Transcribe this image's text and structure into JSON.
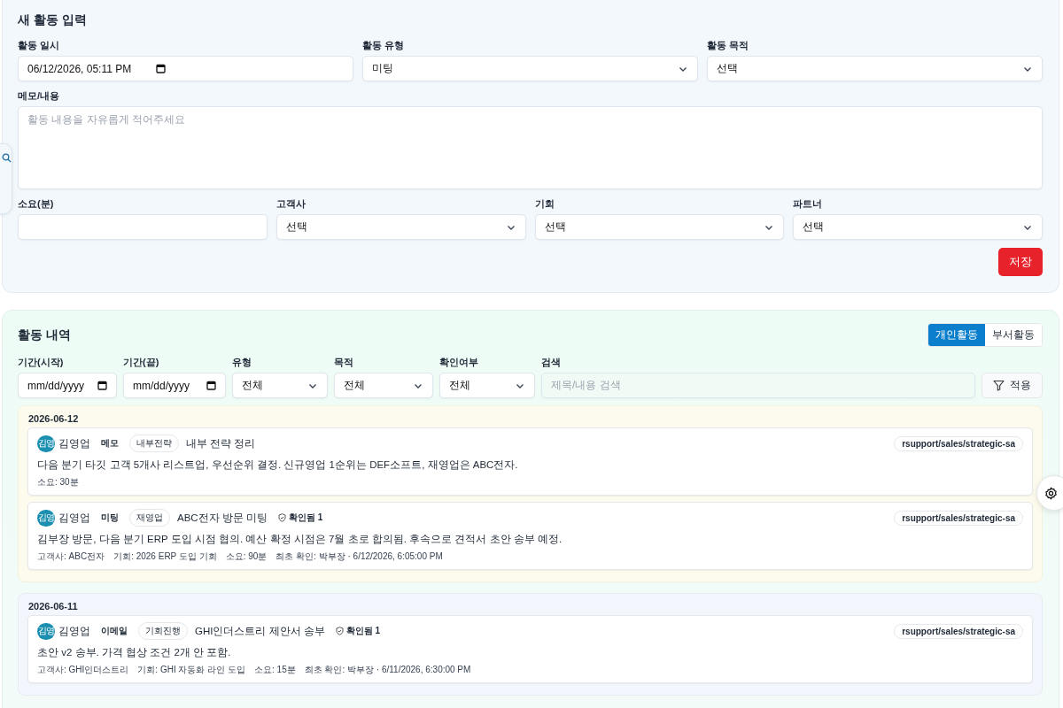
{
  "entry_form": {
    "title": "새 활동 입력",
    "rows": [
      [
        {
          "label": "활동 일시",
          "kind": "datetime",
          "value": "06/12/2026, 05:11 PM"
        },
        {
          "label": "활동 유형",
          "kind": "select",
          "value": "미팅"
        },
        {
          "label": "활동 목적",
          "kind": "select",
          "value": "선택"
        }
      ],
      [
        {
          "label": "메모/내용",
          "kind": "textarea",
          "placeholder": "활동 내용을 자유롭게 적어주세요"
        }
      ],
      [
        {
          "label": "소요(분)",
          "kind": "text"
        },
        {
          "label": "고객사",
          "kind": "select",
          "value": "선택"
        },
        {
          "label": "기회",
          "kind": "select",
          "value": "선택"
        },
        {
          "label": "파트너",
          "kind": "select",
          "value": "선택"
        }
      ]
    ],
    "save_button": "저장"
  },
  "history": {
    "title": "활동 내역",
    "tabs": [
      {
        "label": "개인활동",
        "selected": true
      },
      {
        "label": "부서활동",
        "selected": false
      }
    ],
    "filters": [
      {
        "label": "기간(시작)",
        "kind": "date",
        "value": "mm/dd/yyyy"
      },
      {
        "label": "기간(끝)",
        "kind": "date",
        "value": "mm/dd/yyyy"
      },
      {
        "label": "유형",
        "kind": "select",
        "value": "전체"
      },
      {
        "label": "목적",
        "kind": "select",
        "value": "전체"
      },
      {
        "label": "확인여부",
        "kind": "select",
        "value": "전체"
      },
      {
        "label": "검색",
        "kind": "search",
        "placeholder": "제목/내용 검색"
      }
    ],
    "apply_button": "적용",
    "groups": [
      {
        "date": "2026-06-12",
        "highlighted": true,
        "items": [
          {
            "avatar": "김영",
            "author": "김영업",
            "type": "메모",
            "tag": "내부전략",
            "title": "내부 전략 정리",
            "path": "rsupport/sales/strategic-sa",
            "body": "다음 분기 타깃 고객 5개사 리스트업, 우선순위 결정. 신규영업 1순위는 DEF소프트, 재영업은 ABC전자.",
            "meta": [
              "소요: 30분"
            ]
          },
          {
            "avatar": "김영",
            "author": "김영업",
            "type": "미팅",
            "tag": "재영업",
            "title": "ABC전자 방문 미팅",
            "confirmation": "확인됨 1",
            "path": "rsupport/sales/strategic-sa",
            "body": "김부장 방문, 다음 분기 ERP 도입 시점 협의. 예산 확정 시점은 7월 초로 합의됨. 후속으로 견적서 초안 송부 예정.",
            "meta": [
              "고객사: ABC전자",
              "기회: 2026 ERP 도입 기회",
              "소요: 90분",
              "최초 확인: 박부장 · 6/12/2026, 6:05:00 PM"
            ]
          }
        ]
      },
      {
        "date": "2026-06-11",
        "highlighted": false,
        "items": [
          {
            "avatar": "김영",
            "author": "김영업",
            "type": "이메일",
            "tag": "기회진행",
            "title": "GHI인더스트리 제안서 송부",
            "confirmation": "확인됨 1",
            "path": "rsupport/sales/strategic-sa",
            "body": "초안 v2 송부. 가격 협상 조건 2개 안 포함.",
            "meta": [
              "고객사: GHI인더스트리",
              "기회: GHI 자동화 라인 도입",
              "소요: 15분",
              "최초 확인: 박부장 · 6/11/2026, 6:30:00 PM"
            ]
          }
        ]
      }
    ]
  }
}
